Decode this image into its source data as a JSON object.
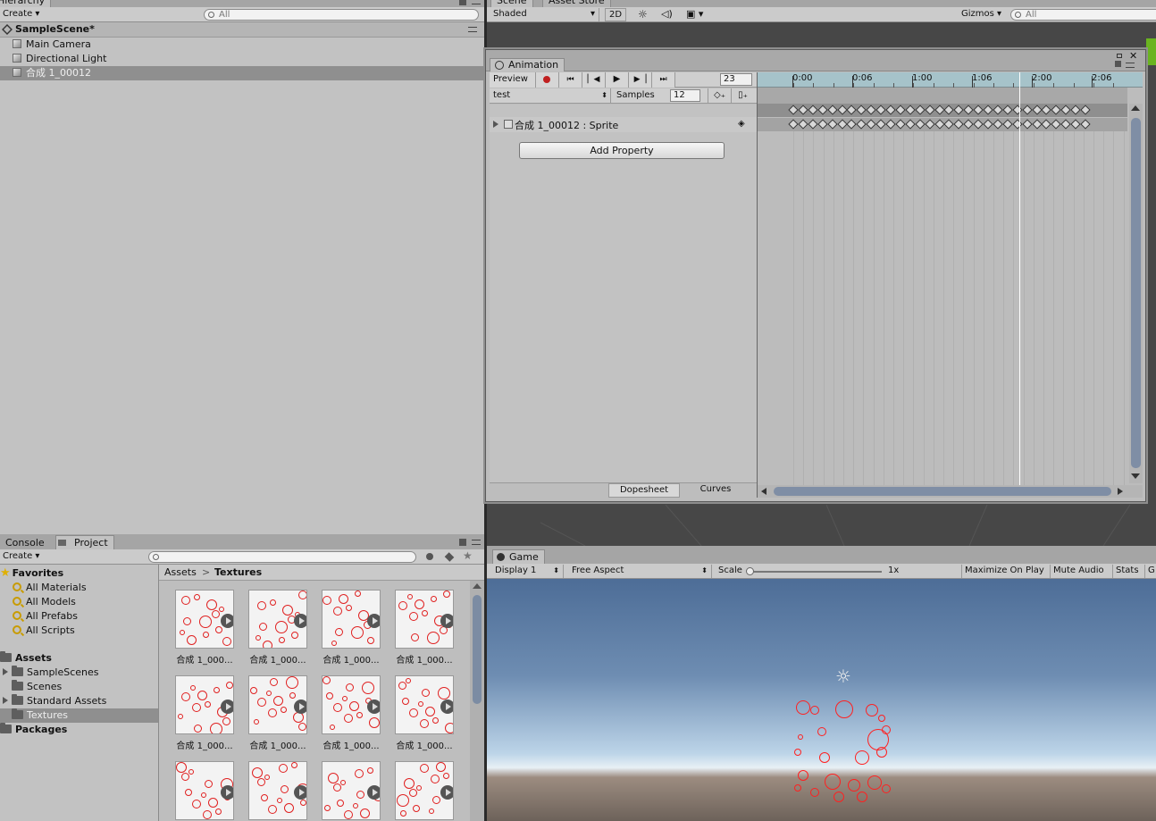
{
  "hierarchy": {
    "tab": "Hierarchy",
    "create": "Create",
    "search_placeholder": "All",
    "scene": "SampleScene*",
    "items": [
      {
        "label": "Main Camera"
      },
      {
        "label": "Directional Light"
      },
      {
        "label": "合成 1_00012"
      }
    ]
  },
  "scene": {
    "tabs": [
      "Scene",
      "Asset Store"
    ],
    "shading": "Shaded",
    "mode_2d": "2D",
    "gizmos": "Gizmos",
    "search_placeholder": "All"
  },
  "animation": {
    "tab": "Animation",
    "preview": "Preview",
    "frame": "23",
    "clip": "test",
    "samples_label": "Samples",
    "samples": "12",
    "property": "合成 1_00012 : Sprite",
    "add_property": "Add Property",
    "ruler": [
      "0:00",
      "0:06",
      "1:00",
      "1:06",
      "2:00",
      "2:06"
    ],
    "dopesheet": "Dopesheet",
    "curves": "Curves"
  },
  "project": {
    "tabs": [
      "Console",
      "Project"
    ],
    "create": "Create",
    "favorites_label": "Favorites",
    "favorites": [
      "All Materials",
      "All Models",
      "All Prefabs",
      "All Scripts"
    ],
    "assets_label": "Assets",
    "assets": [
      "SampleScenes",
      "Scenes",
      "Standard Assets",
      "Textures"
    ],
    "packages_label": "Packages",
    "breadcrumb_root": "Assets",
    "breadcrumb_current": "Textures",
    "thumb_label": "合成 1_000..."
  },
  "game": {
    "tab": "Game",
    "display": "Display 1",
    "aspect": "Free Aspect",
    "scale_label": "Scale",
    "scale_value": "1x",
    "maximize": "Maximize On Play",
    "mute": "Mute Audio",
    "stats": "Stats",
    "gizmos_short": "G"
  }
}
